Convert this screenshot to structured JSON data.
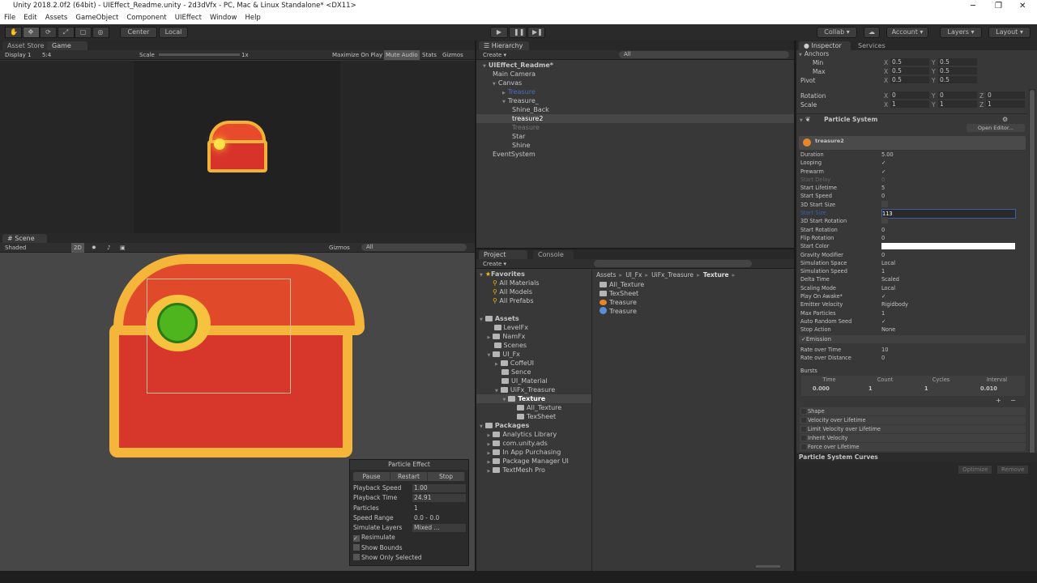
{
  "window": {
    "title": "Unity 2018.2.0f2 (64bit) - UIEffect_Readme.unity - 2d3dVfx - PC, Mac & Linux Standalone* <DX11>",
    "minimize": "─",
    "maximize": "❐",
    "close": "✕"
  },
  "menu": [
    "File",
    "Edit",
    "Assets",
    "GameObject",
    "Component",
    "UIEffect",
    "Window",
    "Help"
  ],
  "toolbar": {
    "tools": [
      "hand-tool",
      "move-tool",
      "rotate-tool",
      "scale-tool",
      "rect-tool",
      "transform-tool"
    ],
    "pivot": "Center",
    "space": "Local",
    "collab": "Collab ▾",
    "account": "Account ▾",
    "layers": "Layers ▾",
    "layout": "Layout ▾"
  },
  "game": {
    "tabs": [
      "Asset Store",
      "Game"
    ],
    "display": "Display 1",
    "aspect": "5:4",
    "scale_label": "Scale",
    "scale_value": "1x",
    "maximize": "Maximize On Play",
    "mute": "Mute Audio",
    "stats": "Stats",
    "gizmos": "Gizmos"
  },
  "scene": {
    "tab": "Scene",
    "shading": "Shaded",
    "mode2d": "2D",
    "gizmos": "Gizmos",
    "search": "All"
  },
  "particle_effect": {
    "title": "Particle Effect",
    "buttons": [
      "Pause",
      "Restart",
      "Stop"
    ],
    "rows": [
      {
        "label": "Playback Speed",
        "value": "1.00"
      },
      {
        "label": "Playback Time",
        "value": "24.91"
      },
      {
        "label": "Particles",
        "value": "1"
      },
      {
        "label": "Speed Range",
        "value": "0.0 - 0.0"
      },
      {
        "label": "Simulate Layers",
        "value": "Mixed ..."
      }
    ],
    "checks": [
      {
        "label": "Resimulate",
        "checked": true
      },
      {
        "label": "Show Bounds",
        "checked": false
      },
      {
        "label": "Show Only Selected",
        "checked": false
      }
    ]
  },
  "hierarchy": {
    "tab": "Hierarchy",
    "create": "Create ▾",
    "search": "All",
    "items": [
      {
        "label": "UIEffect_Readme*",
        "depth": 0,
        "fold": "open",
        "bold": true
      },
      {
        "label": "Main Camera",
        "depth": 1
      },
      {
        "label": "Canvas",
        "depth": 1,
        "fold": "open"
      },
      {
        "label": "Treasure",
        "depth": 2,
        "fold": "closed",
        "style": "prefab"
      },
      {
        "label": "Treasure_",
        "depth": 2,
        "fold": "open"
      },
      {
        "label": "Shine_Back",
        "depth": 3
      },
      {
        "label": "treasure2",
        "depth": 3,
        "selected": true
      },
      {
        "label": "Treasure",
        "depth": 3,
        "style": "disabled"
      },
      {
        "label": "Star",
        "depth": 3
      },
      {
        "label": "Shine",
        "depth": 3
      },
      {
        "label": "EventSystem",
        "depth": 1
      }
    ]
  },
  "project": {
    "tabs": [
      "Project",
      "Console"
    ],
    "create": "Create ▾",
    "favorites": {
      "label": "Favorites",
      "items": [
        "All Materials",
        "All Models",
        "All Prefabs"
      ]
    },
    "tree": [
      {
        "label": "Assets",
        "depth": 0,
        "fold": "open",
        "bold": true
      },
      {
        "label": "LevelFx",
        "depth": 1
      },
      {
        "label": "NamFx",
        "depth": 1,
        "fold": "closed"
      },
      {
        "label": "Scenes",
        "depth": 1
      },
      {
        "label": "UI_Fx",
        "depth": 1,
        "fold": "open"
      },
      {
        "label": "CoffeUI",
        "depth": 2,
        "fold": "closed"
      },
      {
        "label": "Sence",
        "depth": 2
      },
      {
        "label": "UI_Material",
        "depth": 2
      },
      {
        "label": "UiFx_Treasure",
        "depth": 2,
        "fold": "open"
      },
      {
        "label": "Texture",
        "depth": 3,
        "fold": "open",
        "selected": true
      },
      {
        "label": "All_Texture",
        "depth": 4
      },
      {
        "label": "TexSheet",
        "depth": 4
      },
      {
        "label": "Packages",
        "depth": 0,
        "fold": "open",
        "bold": true
      },
      {
        "label": "Analytics Library",
        "depth": 1,
        "fold": "closed"
      },
      {
        "label": "com.unity.ads",
        "depth": 1,
        "fold": "closed"
      },
      {
        "label": "In App Purchasing",
        "depth": 1,
        "fold": "closed"
      },
      {
        "label": "Package Manager UI",
        "depth": 1,
        "fold": "closed"
      },
      {
        "label": "TextMesh Pro",
        "depth": 1,
        "fold": "closed"
      }
    ],
    "breadcrumb": [
      "Assets",
      "UI_Fx",
      "UiFx_Treasure",
      "Texture"
    ],
    "files": [
      {
        "label": "All_Texture",
        "icon": "folder"
      },
      {
        "label": "TexSheet",
        "icon": "folder"
      },
      {
        "label": "Treasure",
        "icon": "prefab"
      },
      {
        "label": "Treasure",
        "icon": "material"
      }
    ]
  },
  "inspector": {
    "tabs": [
      "Inspector",
      "Services"
    ],
    "anchors": "Anchors",
    "transform": [
      {
        "label": "Min",
        "x": "0.5",
        "y": "0.5"
      },
      {
        "label": "Max",
        "x": "0.5",
        "y": "0.5"
      },
      {
        "label": "Pivot",
        "x": "0.5",
        "y": "0.5"
      },
      {
        "label": "Rotation",
        "x": "0",
        "y": "0",
        "z": "0"
      },
      {
        "label": "Scale",
        "x": "1",
        "y": "1",
        "z": "1"
      }
    ],
    "component": "Particle System",
    "open_editor": "Open Editor...",
    "system_name": "treasure2",
    "props": [
      {
        "label": "Duration",
        "value": "5.00"
      },
      {
        "label": "Looping",
        "check": true
      },
      {
        "label": "Prewarm",
        "check": true
      },
      {
        "label": "Start Delay",
        "value": "0",
        "disabled": true
      },
      {
        "label": "Start Lifetime",
        "value": "5"
      },
      {
        "label": "Start Speed",
        "value": "0"
      },
      {
        "label": "3D Start Size",
        "check": false
      },
      {
        "label": "Start Size",
        "value": "113",
        "editing": true
      },
      {
        "label": "3D Start Rotation",
        "check": false
      },
      {
        "label": "Start Rotation",
        "value": "0"
      },
      {
        "label": "Flip Rotation",
        "value": "0"
      },
      {
        "label": "Start Color",
        "color": "#ffffff"
      },
      {
        "label": "Gravity Modifier",
        "value": "0"
      },
      {
        "label": "Simulation Space",
        "value": "Local"
      },
      {
        "label": "Simulation Speed",
        "value": "1"
      },
      {
        "label": "Delta Time",
        "value": "Scaled"
      },
      {
        "label": "Scaling Mode",
        "value": "Local"
      },
      {
        "label": "Play On Awake*",
        "check": true
      },
      {
        "label": "Emitter Velocity",
        "value": "Rigidbody"
      },
      {
        "label": "Max Particles",
        "value": "1"
      },
      {
        "label": "Auto Random Seed",
        "check": true
      },
      {
        "label": "Stop Action",
        "value": "None"
      }
    ],
    "emission": {
      "label": "Emission",
      "rows": [
        {
          "label": "Rate over Time",
          "value": "10"
        },
        {
          "label": "Rate over Distance",
          "value": "0"
        }
      ],
      "bursts": "Bursts",
      "burst_headers": [
        "Time",
        "Count",
        "Cycles",
        "Interval"
      ],
      "burst_row": [
        "0.000",
        "1",
        "1",
        "0.010"
      ]
    },
    "modules": [
      "Shape",
      "Velocity over Lifetime",
      "Limit Velocity over Lifetime",
      "Inherit Velocity",
      "Force over Lifetime"
    ],
    "curves": "Particle System Curves",
    "optimize": "Optimize",
    "remove": "Remove"
  },
  "colors": {
    "accent_selected": "#3d5fa8",
    "prefab_text": "#4d6cc0"
  }
}
